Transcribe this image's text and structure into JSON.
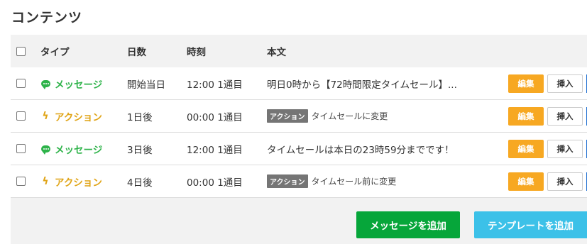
{
  "page": {
    "title": "コンテンツ"
  },
  "table": {
    "headers": {
      "type": "タイプ",
      "day": "日数",
      "time": "時刻",
      "body": "本文"
    },
    "rows": [
      {
        "type_label": "メッセージ",
        "day": "開始当日",
        "time": "12:00 1通目",
        "body_tag": "",
        "body": "明日0時から【72時間限定タイムセール】..."
      },
      {
        "type_label": "アクション",
        "day": "1日後",
        "time": "00:00 1通目",
        "body_tag": "アクション",
        "body": "タイムセールに変更"
      },
      {
        "type_label": "メッセージ",
        "day": "3日後",
        "time": "12:00 1通目",
        "body_tag": "",
        "body": "タイムセールは本日の23時59分までです！"
      },
      {
        "type_label": "アクション",
        "day": "4日後",
        "time": "00:00 1通目",
        "body_tag": "アクション",
        "body": "タイムセール前に変更"
      }
    ],
    "row_buttons": {
      "edit": "編集",
      "insert": "挿入"
    }
  },
  "footer": {
    "add_message": "メッセージを追加",
    "add_template": "テンプレートを追加"
  },
  "colors": {
    "message": "#2eb34a",
    "action": "#e0a416",
    "edit": "#f7a822",
    "add_message": "#06a63a",
    "add_template": "#3cc1e8"
  }
}
